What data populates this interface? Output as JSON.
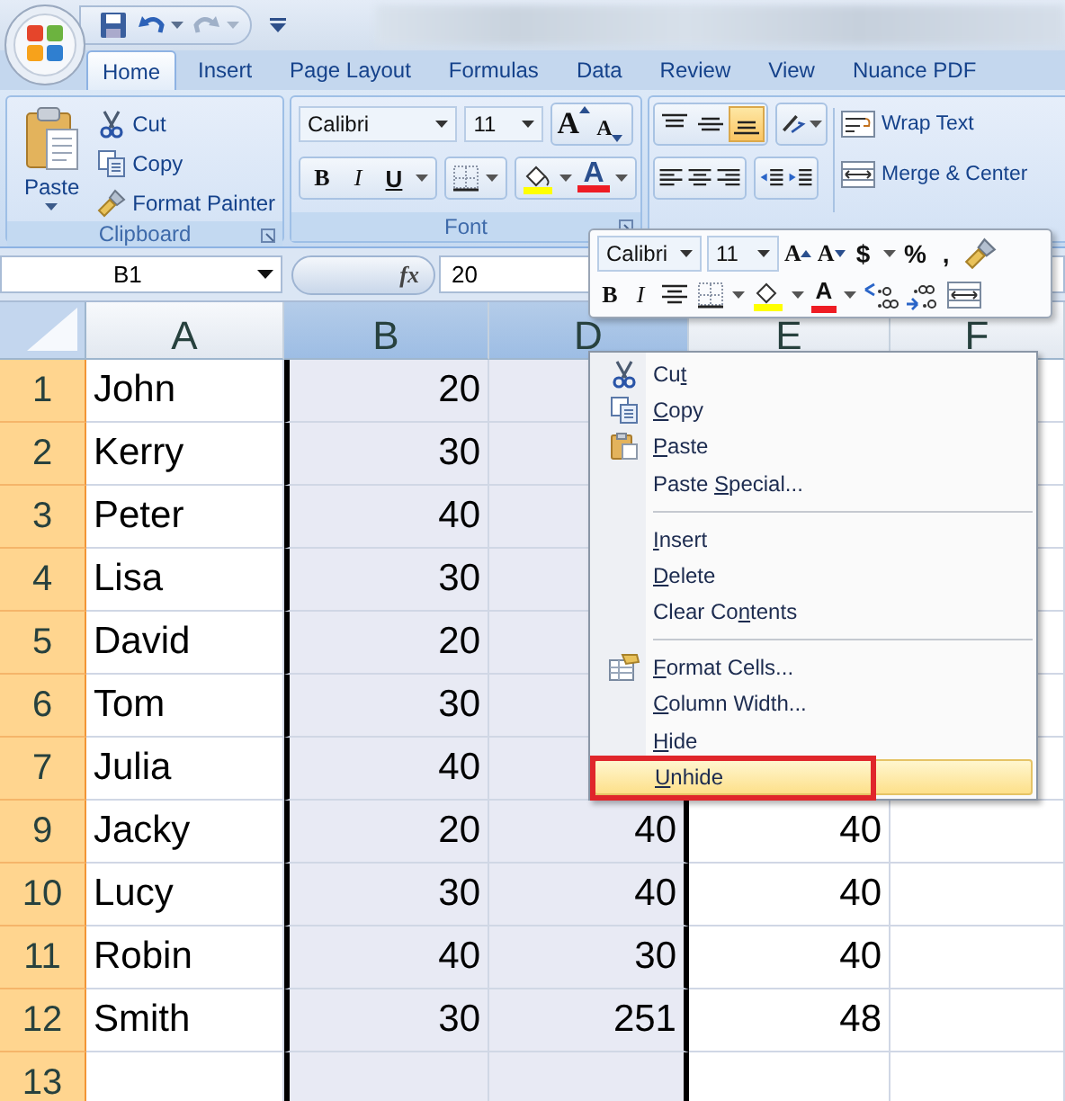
{
  "tabs": [
    {
      "label": "Home",
      "selected": true
    },
    {
      "label": "Insert",
      "selected": false
    },
    {
      "label": "Page Layout",
      "selected": false
    },
    {
      "label": "Formulas",
      "selected": false
    },
    {
      "label": "Data",
      "selected": false
    },
    {
      "label": "Review",
      "selected": false
    },
    {
      "label": "View",
      "selected": false
    },
    {
      "label": "Nuance PDF",
      "selected": false
    }
  ],
  "ribbon": {
    "clipboard": {
      "label": "Clipboard",
      "paste": "Paste",
      "commands": [
        "Cut",
        "Copy",
        "Format Painter"
      ]
    },
    "font": {
      "label": "Font",
      "font_name": "Calibri",
      "font_size": "11",
      "grow": "A",
      "shrink": "A",
      "bold": "B",
      "italic": "I",
      "underline": "U",
      "font_color": "A"
    },
    "alignment": {
      "vertical_align": [
        {
          "selected": false
        },
        {
          "selected": false
        },
        {
          "selected": true
        }
      ],
      "wrap_text": "Wrap Text",
      "merge": "Merge & Center"
    }
  },
  "formula_bar": {
    "name_box": "B1",
    "function_label": "fx",
    "value": "20"
  },
  "columns": [
    {
      "label": "A",
      "selected": false
    },
    {
      "label": "B",
      "selected": true
    },
    {
      "label": "D",
      "selected": true
    },
    {
      "label": "E",
      "selected": false
    },
    {
      "label": "F",
      "selected": false
    }
  ],
  "rows": [
    {
      "header": "1",
      "selected": true,
      "cells": [
        "John",
        "20"
      ]
    },
    {
      "header": "2",
      "selected": true,
      "cells": [
        "Kerry",
        "30"
      ]
    },
    {
      "header": "3",
      "selected": true,
      "cells": [
        "Peter",
        "40"
      ]
    },
    {
      "header": "4",
      "selected": true,
      "cells": [
        "Lisa",
        "30"
      ]
    },
    {
      "header": "5",
      "selected": true,
      "cells": [
        "David",
        "20"
      ]
    },
    {
      "header": "6",
      "selected": true,
      "cells": [
        "Tom",
        "30"
      ]
    },
    {
      "header": "7",
      "selected": true,
      "cells": [
        "Julia",
        "40"
      ]
    },
    {
      "header": "9",
      "selected": true,
      "cells": [
        "Jacky",
        "20",
        "40",
        "40"
      ]
    },
    {
      "header": "10",
      "selected": true,
      "cells": [
        "Lucy",
        "30",
        "40",
        "40"
      ]
    },
    {
      "header": "11",
      "selected": true,
      "cells": [
        "Robin",
        "40",
        "30",
        "40"
      ]
    },
    {
      "header": "12",
      "selected": true,
      "cells": [
        "Smith",
        "30",
        "251",
        "48"
      ]
    },
    {
      "header": "13",
      "selected": true
    }
  ],
  "mini_toolbar": {
    "font_name": "Calibri",
    "font_size": "11",
    "grow": "A",
    "shrink": "A",
    "currency": "$",
    "percent": "%",
    "comma": ",",
    "bold": "B",
    "italic": "I",
    "font_color": "A"
  },
  "context_menu": {
    "items": [
      {
        "kind": "item",
        "text_before": "Cu",
        "access_key": "t",
        "selected": false,
        "boxed": false
      },
      {
        "kind": "item",
        "access_key": "C",
        "text_after": "opy",
        "selected": false,
        "boxed": false
      },
      {
        "kind": "item",
        "access_key": "P",
        "text_after": "aste",
        "selected": false,
        "boxed": false
      },
      {
        "kind": "item",
        "text_before": "Paste ",
        "access_key": "S",
        "text_after": "pecial...",
        "selected": false,
        "boxed": false
      },
      {
        "kind": "separator"
      },
      {
        "kind": "item",
        "access_key": "I",
        "text_after": "nsert",
        "selected": false,
        "boxed": false
      },
      {
        "kind": "item",
        "access_key": "D",
        "text_after": "elete",
        "selected": false,
        "boxed": false
      },
      {
        "kind": "item",
        "text_before": "Clear Co",
        "access_key": "n",
        "text_after": "tents",
        "selected": false,
        "boxed": false
      },
      {
        "kind": "separator"
      },
      {
        "kind": "item",
        "access_key": "F",
        "text_after": "ormat Cells...",
        "selected": false,
        "boxed": false
      },
      {
        "kind": "item",
        "access_key": "C",
        "text_after": "olumn Width...",
        "selected": false,
        "boxed": false
      },
      {
        "kind": "item",
        "access_key": "H",
        "text_after": "ide",
        "selected": false,
        "boxed": false
      },
      {
        "kind": "item",
        "access_key": "U",
        "text_after": "nhide",
        "selected": true,
        "boxed": true
      }
    ]
  }
}
